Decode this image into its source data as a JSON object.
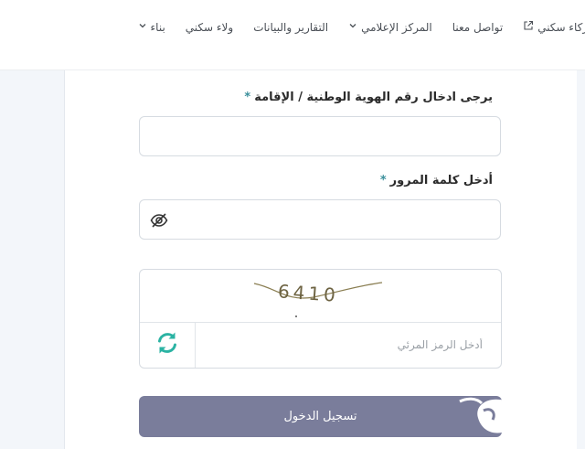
{
  "nav": {
    "items": [
      {
        "label": "بناء",
        "icon": "chevron-down-icon"
      },
      {
        "label": "ولاء سكني",
        "icon": ""
      },
      {
        "label": "التقارير والبيانات",
        "icon": ""
      },
      {
        "label": "المركز الإعلامي",
        "icon": "chevron-down-icon"
      },
      {
        "label": "تواصل معنا",
        "icon": ""
      },
      {
        "label": "شركاء سكني",
        "icon": "external-link-icon"
      }
    ]
  },
  "form": {
    "id_label": "يرجى ادخال رقم الهوية الوطنية / الإقامة",
    "id_value": "",
    "password_label": "أدخل كلمة المرور",
    "password_value": "",
    "required_mark": "*",
    "captcha_text": "6410",
    "captcha_placeholder": "أدخل الرمز المرئي",
    "submit_label": "تسجيل الدخول"
  },
  "colors": {
    "accent": "#3a8f9b",
    "button": "#7a7d9b",
    "refresh": "#2bb3a3"
  }
}
